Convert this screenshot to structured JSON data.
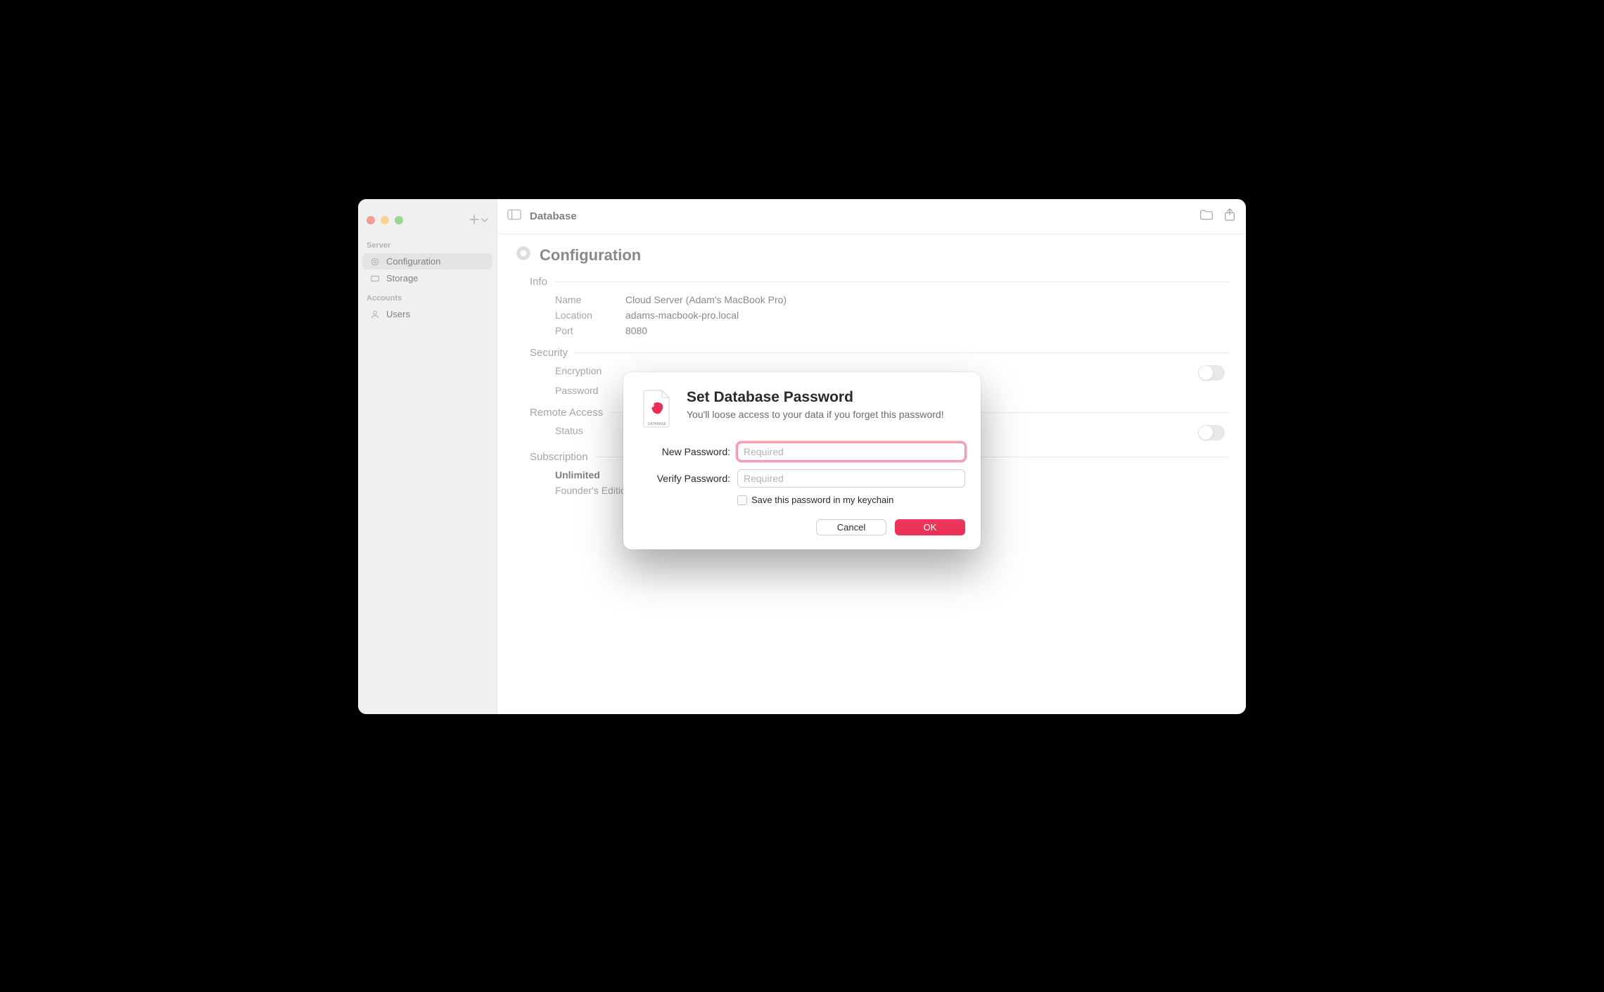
{
  "colors": {
    "accent": "#e82f55"
  },
  "toolbar": {
    "title": "Database"
  },
  "sidebar": {
    "sections": {
      "server": {
        "label": "Server"
      },
      "accounts": {
        "label": "Accounts"
      }
    },
    "items": {
      "configuration": {
        "label": "Configuration"
      },
      "storage": {
        "label": "Storage"
      },
      "users": {
        "label": "Users"
      }
    }
  },
  "page": {
    "title": "Configuration"
  },
  "info": {
    "header": "Info",
    "name_label": "Name",
    "name_value": "Cloud Server (Adam's MacBook Pro)",
    "location_label": "Location",
    "location_value": "adams-macbook-pro.local",
    "port_label": "Port",
    "port_value": "8080"
  },
  "security": {
    "header": "Security",
    "encryption_label": "Encryption",
    "password_label": "Password"
  },
  "remote": {
    "header": "Remote Access",
    "status_label": "Status"
  },
  "subscription": {
    "header": "Subscription",
    "plan": "Unlimited",
    "detail": "Founder's Edition"
  },
  "sheet": {
    "title": "Set Database Password",
    "subtitle": "You'll loose access to your data if you forget this password!",
    "new_label": "New Password:",
    "verify_label": "Verify Password:",
    "placeholder": "Required",
    "keychain_label": "Save this password in my keychain",
    "cancel": "Cancel",
    "ok": "OK",
    "icon_caption": "DATABASE"
  }
}
